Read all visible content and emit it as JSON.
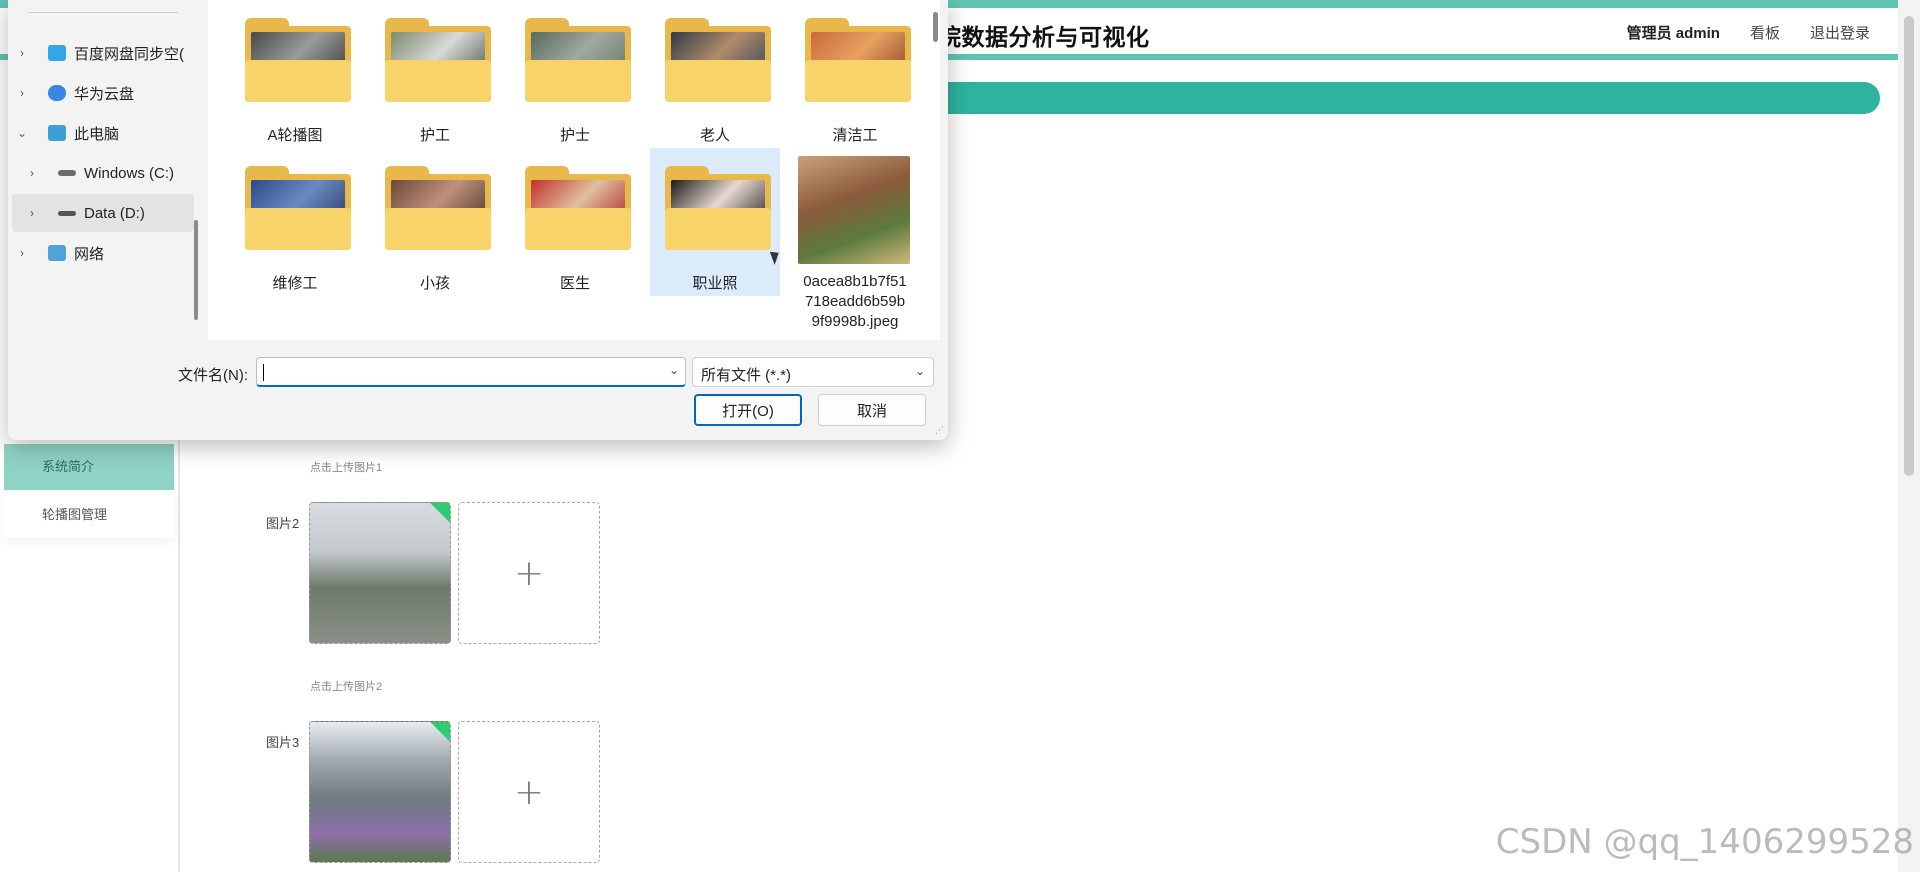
{
  "app": {
    "title": "医院数据分析与可视化",
    "title_visible": "院数据分析与可视化",
    "nav": {
      "user": "管理员 admin",
      "dashboard": "看板",
      "logout": "退出登录"
    },
    "sidebar": [
      {
        "label": "系统简介"
      },
      {
        "label": "轮播图管理"
      }
    ],
    "form": {
      "hint1": "点击上传图片1",
      "label2": "图片2",
      "hint2": "点击上传图片2",
      "label3": "图片3",
      "plus": "+"
    },
    "accent_color": "#2eb39f"
  },
  "dialog": {
    "nav_items": [
      {
        "label": "百度网盘同步空间",
        "shown": "百度网盘同步空(",
        "icon": "baidu-cloud-icon"
      },
      {
        "label": "华为云盘",
        "icon": "huawei-cloud-icon"
      },
      {
        "label": "此电脑",
        "icon": "this-pc-icon"
      },
      {
        "label": "Windows (C:)",
        "icon": "drive-icon"
      },
      {
        "label": "Data (D:)",
        "icon": "drive-icon"
      },
      {
        "label": "网络",
        "icon": "network-icon"
      }
    ],
    "files": [
      {
        "label": "A轮播图",
        "type": "folder"
      },
      {
        "label": "护工",
        "type": "folder"
      },
      {
        "label": "护士",
        "type": "folder"
      },
      {
        "label": "老人",
        "type": "folder"
      },
      {
        "label": "清洁工",
        "type": "folder"
      },
      {
        "label": "维修工",
        "type": "folder"
      },
      {
        "label": "小孩",
        "type": "folder"
      },
      {
        "label": "医生",
        "type": "folder"
      },
      {
        "label": "职业照",
        "type": "folder",
        "selected": true
      },
      {
        "label_line1": "0acea8b1b7f51",
        "label_line2": "718eadd6b59b",
        "label_line3": "9f9998b.jpeg",
        "type": "image"
      }
    ],
    "filename_label": "文件名(N):",
    "filename_value": "",
    "filter_value": "所有文件 (*.*)",
    "open_button": "打开(O)",
    "cancel_button": "取消"
  },
  "watermark": "CSDN @qq_1406299528"
}
